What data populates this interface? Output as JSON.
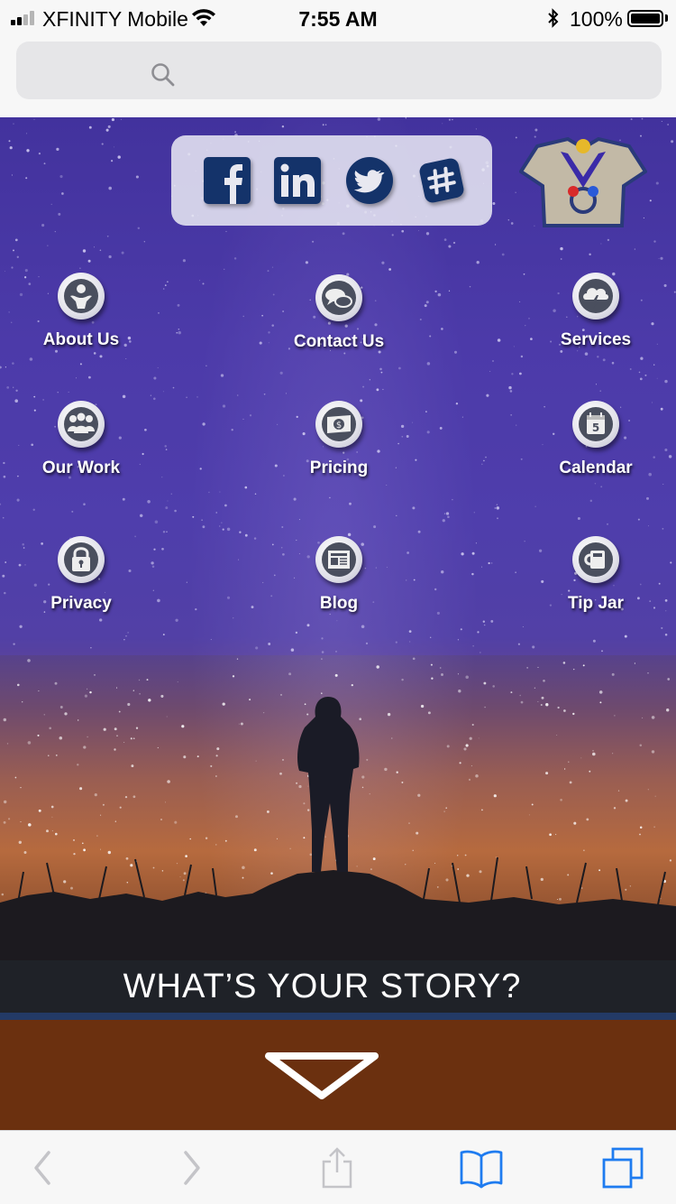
{
  "status_bar": {
    "carrier": "XFINITY Mobile",
    "time": "7:55 AM",
    "battery_percent": "100%"
  },
  "address_bar": {
    "placeholder": ""
  },
  "social": [
    {
      "name": "facebook",
      "icon": "facebook-icon"
    },
    {
      "name": "linkedin",
      "icon": "linkedin-icon"
    },
    {
      "name": "twitter",
      "icon": "twitter-icon"
    },
    {
      "name": "slack",
      "icon": "slack-icon"
    }
  ],
  "nav": {
    "items": [
      {
        "label": "About Us",
        "icon": "person-icon"
      },
      {
        "label": "Contact Us",
        "icon": "chat-bubbles-icon"
      },
      {
        "label": "Services",
        "icon": "cloud-lightning-icon"
      },
      {
        "label": "Our Work",
        "icon": "group-icon"
      },
      {
        "label": "Pricing",
        "icon": "money-bill-icon"
      },
      {
        "label": "Calendar",
        "icon": "calendar-icon"
      },
      {
        "label": "Privacy",
        "icon": "lock-icon"
      },
      {
        "label": "Blog",
        "icon": "newspaper-icon"
      },
      {
        "label": "Tip Jar",
        "icon": "mug-icon"
      }
    ]
  },
  "banner": {
    "headline": "WHAT’S YOUR STORY?"
  },
  "colors": {
    "social_icon": "#14336a",
    "banner_bg": "#1f2228",
    "stripe": "#233a66",
    "brown": "#6b300f",
    "ios_blue": "#1f7cf0",
    "toolbar_gray": "#c4c4c8"
  }
}
